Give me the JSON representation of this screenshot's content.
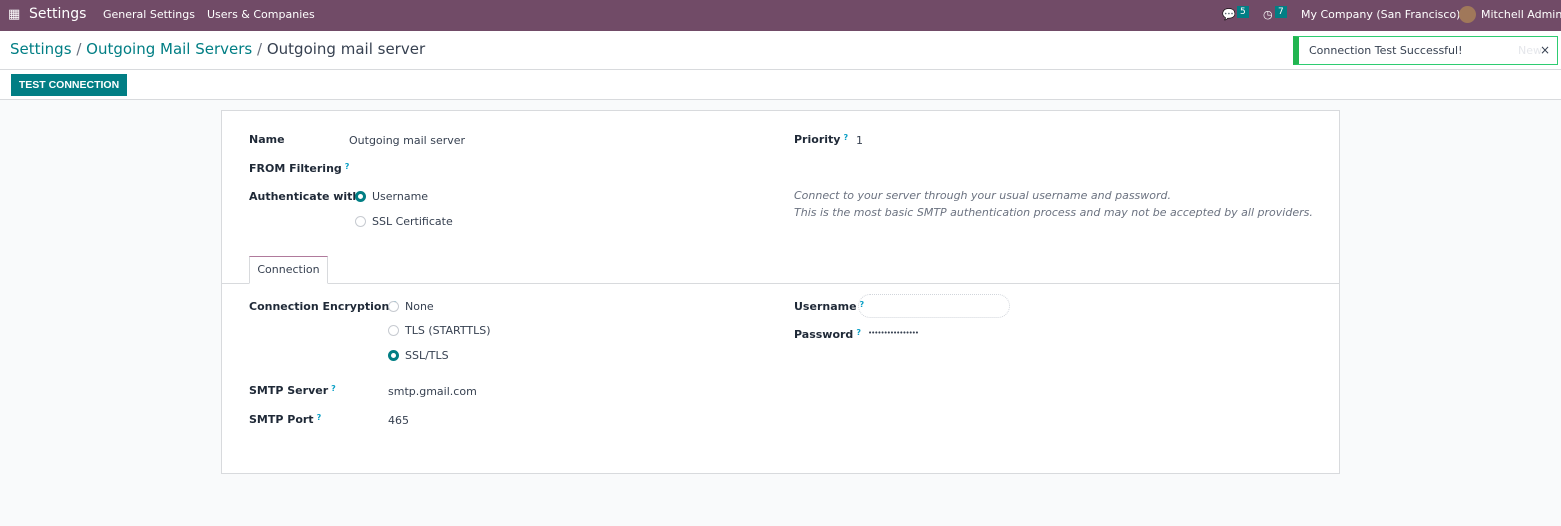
{
  "navbar": {
    "app": "Settings",
    "menus": [
      "General Settings",
      "Users & Companies"
    ],
    "messages_count": "5",
    "activities_count": "7",
    "company": "My Company (San Francisco)",
    "user": "Mitchell Admin",
    "color": "#714b67"
  },
  "breadcrumb": {
    "items": [
      "Settings",
      "Outgoing Mail Servers"
    ],
    "current": "Outgoing mail server"
  },
  "toolbar": {
    "test_connection": "TEST CONNECTION"
  },
  "toast": {
    "message": "Connection Test Successful!",
    "behind_text": "New"
  },
  "form": {
    "name_label": "Name",
    "name_value": "Outgoing mail server",
    "priority_label": "Priority",
    "priority_value": "1",
    "from_filtering_label": "FROM Filtering",
    "authenticate_label": "Authenticate with",
    "auth_options": [
      {
        "label": "Username",
        "selected": true
      },
      {
        "label": "SSL Certificate",
        "selected": false
      }
    ],
    "auth_hint": [
      "Connect to your server through your usual username and password.",
      "This is the most basic SMTP authentication process and may not be accepted by all providers."
    ],
    "tabs": [
      "Connection"
    ],
    "encryption_label": "Connection Encryption",
    "encryption_options": [
      {
        "label": "None",
        "selected": false
      },
      {
        "label": "TLS (STARTTLS)",
        "selected": false
      },
      {
        "label": "SSL/TLS",
        "selected": true
      }
    ],
    "smtp_server_label": "SMTP Server",
    "smtp_server_value": "smtp.gmail.com",
    "smtp_port_label": "SMTP Port",
    "smtp_port_value": "465",
    "username_label": "Username",
    "username_value": "",
    "password_label": "Password",
    "password_value": "••••••••••••••••",
    "help_mark": "?"
  }
}
